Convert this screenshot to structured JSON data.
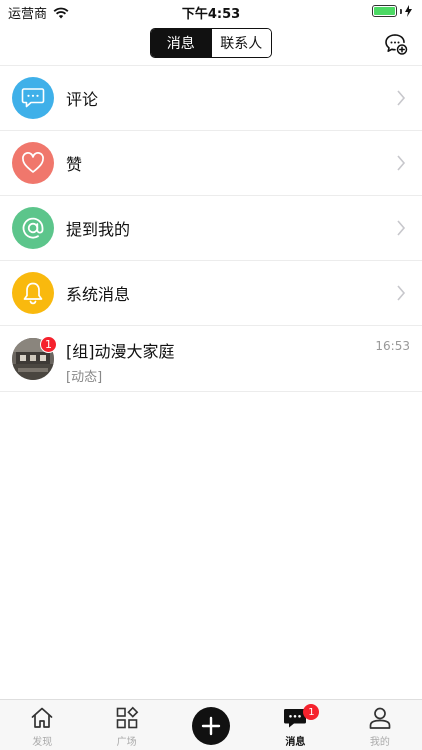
{
  "status_bar": {
    "carrier": "运营商",
    "time": "下午4:53",
    "battery_level": 1.0
  },
  "nav": {
    "segments": [
      {
        "label": "消息",
        "active": true
      },
      {
        "label": "联系人",
        "active": false
      }
    ],
    "action_icon": "chat-add-icon"
  },
  "list": [
    {
      "label": "评论",
      "icon": "comment-icon",
      "color": "#3fb0e9"
    },
    {
      "label": "赞",
      "icon": "heart-icon",
      "color": "#f0776c"
    },
    {
      "label": "提到我的",
      "icon": "at-icon",
      "color": "#5cc58b"
    },
    {
      "label": "系统消息",
      "icon": "bell-icon",
      "color": "#f9b90e"
    }
  ],
  "chat": {
    "title": "[组]动漫大家庭",
    "subtitle": "[动态]",
    "time": "16:53",
    "badge": "1"
  },
  "tabbar": {
    "tabs": [
      {
        "label": "发现",
        "icon": "home-icon",
        "active": false
      },
      {
        "label": "广场",
        "icon": "grid-icon",
        "active": false
      },
      {
        "label": "",
        "icon": "plus-icon",
        "active": false
      },
      {
        "label": "消息",
        "icon": "message-icon",
        "active": true,
        "badge": "1"
      },
      {
        "label": "我的",
        "icon": "user-icon",
        "active": false
      }
    ]
  }
}
